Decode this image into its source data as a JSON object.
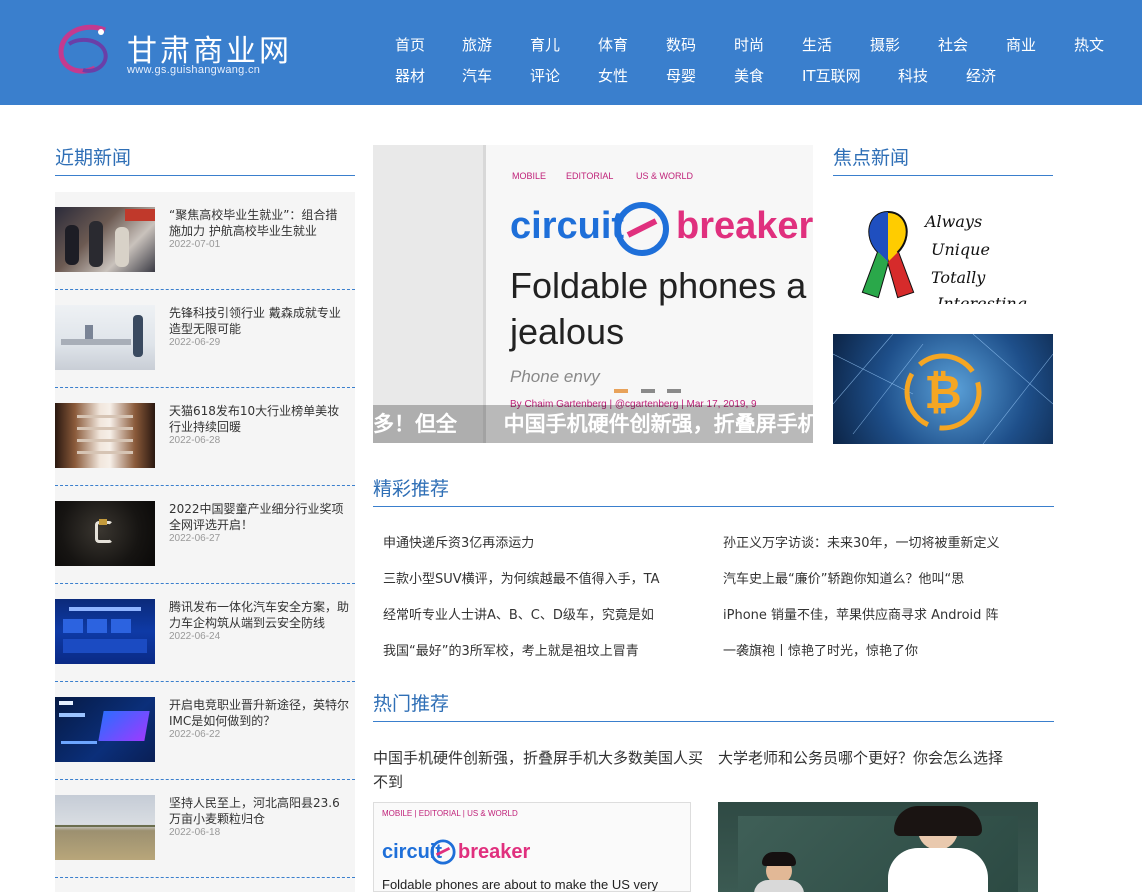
{
  "header": {
    "logo_title": "甘肃商业网",
    "logo_url": "www.gs.guishangwang.cn",
    "nav": [
      "首页",
      "旅游",
      "育儿",
      "体育",
      "数码",
      "时尚",
      "生活",
      "摄影",
      "社会",
      "商业",
      "热文",
      "器材",
      "汽车",
      "评论",
      "女性",
      "母婴",
      "美食",
      "IT互联网",
      "科技",
      "经济"
    ]
  },
  "recent": {
    "title": "近期新闻",
    "items": [
      {
        "title": "“聚焦高校毕业生就业”：组合措施加力 护航高校毕业生就业",
        "date": "2022-07-01"
      },
      {
        "title": "先锋科技引领行业 戴森成就专业造型无限可能",
        "date": "2022-06-29"
      },
      {
        "title": "天猫618发布10大行业榜单美妆行业持续回暖",
        "date": "2022-06-28"
      },
      {
        "title": "2022中国婴童产业细分行业奖项全网评选开启！",
        "date": "2022-06-27"
      },
      {
        "title": "腾讯发布一体化汽车安全方案，助力车企构筑从端到云安全防线",
        "date": "2022-06-24"
      },
      {
        "title": "开启电竞职业晋升新途径，英特尔IMC是如何做到的？",
        "date": "2022-06-22"
      },
      {
        "title": "坚持人民至上，河北高阳县23.6万亩小麦颗粒归仓",
        "date": "2022-06-18"
      }
    ]
  },
  "slider": {
    "caption_prev": "多！但全",
    "caption": "中国手机硬件创新强，折叠屏手机大多数美国人买不到",
    "img_tag1": "MOBILE",
    "img_tag2": "EDITORIAL",
    "img_tag3": "US & WORLD",
    "img_brand1": "circuit",
    "img_brand2": "breaker",
    "img_headline1": "Foldable phones a",
    "img_headline2": "jealous",
    "img_sub": "Phone envy",
    "img_byline": "By Chaim Gartenberg | @cgartenberg | Mar 17, 2019, 9"
  },
  "focus": {
    "title": "焦点新闻",
    "img1_text": [
      "Always",
      "Unique",
      "Totally",
      "Interesting"
    ]
  },
  "recommend": {
    "title": "精彩推荐",
    "links": [
      "申通快递斥资3亿再添运力",
      "孙正义万字访谈：未来30年，一切将被重新定义",
      "三款小型SUV横评，为何缤越最不值得入手，TA",
      "汽车史上最“廉价”轿跑你知道么？他叫“思",
      "经常听专业人士讲A、B、C、D级车，究竟是如",
      "iPhone 销量不佳，苹果供应商寻求 Android 阵",
      "我国“最好”的3所军校，考上就是祖坟上冒青",
      "一袭旗袍丨惊艳了时光，惊艳了你"
    ]
  },
  "hot": {
    "title": "热门推荐",
    "items": [
      {
        "title": "中国手机硬件创新强，折叠屏手机大多数美国人买不到"
      },
      {
        "title": "大学老师和公务员哪个更好？你会怎么选择"
      }
    ],
    "img1_text": "Foldable phones are about to make the US very"
  },
  "colors": {
    "brand_blue": "#3a7fcd",
    "title_blue": "#2f6fb6"
  }
}
